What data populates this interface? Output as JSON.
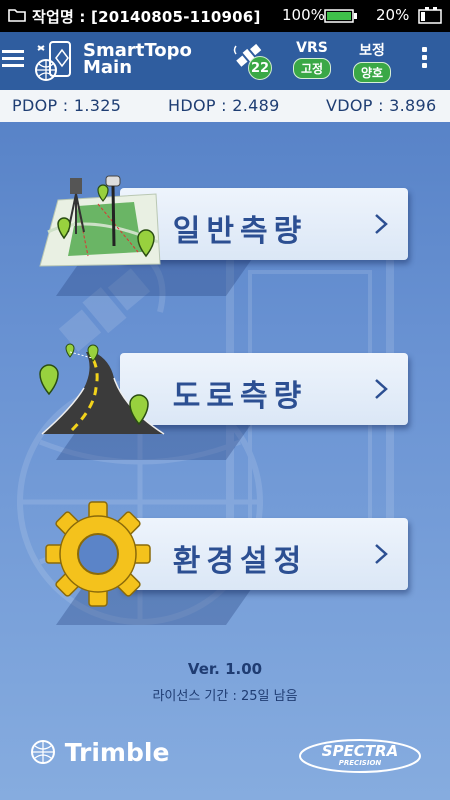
{
  "statusbar": {
    "title": "작업명 : [20140805-110906]",
    "battery1_pct": "100%",
    "battery2_pct": "20%"
  },
  "header": {
    "app_title_line1": "SmartTopo",
    "app_title_line2": "Main",
    "satellite_count": "22",
    "vrs_label": "VRS",
    "vrs_status": "고정",
    "correction_label": "보정",
    "correction_status": "양호"
  },
  "dop": {
    "pdop": "PDOP : 1.325",
    "hdop": "HDOP : 2.489",
    "vdop": "VDOP : 3.896"
  },
  "menu": {
    "general_survey": "일반측량",
    "road_survey": "도로측량",
    "settings": "환경설정"
  },
  "footer": {
    "version": "Ver. 1.00",
    "license": "라이선스 기간 : 25일 남음",
    "trimble": "Trimble",
    "spectra_line1": "SPECTRA",
    "spectra_line2": "PRECISION"
  },
  "colors": {
    "header_bg": "#2f5d9f",
    "status_green": "#3aa846",
    "menu_text": "#2c4f92",
    "dop_text": "#1f3e73"
  },
  "icons": {
    "folder": "folder-icon",
    "battery": "battery-icon",
    "menu": "hamburger-menu-icon",
    "satellite": "satellite-icon",
    "more": "more-vertical-icon",
    "chevron": "chevron-right-icon",
    "map_pin": "map-pin-icon",
    "gear": "gear-icon"
  }
}
